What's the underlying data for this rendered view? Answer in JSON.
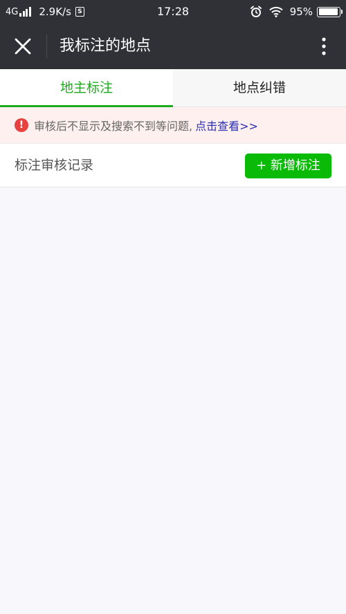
{
  "status_bar": {
    "network": "4G",
    "speed": "2.9K/s",
    "sim_label": "S",
    "time": "17:28",
    "battery": "95%"
  },
  "nav": {
    "title": "我标注的地点"
  },
  "tabs": [
    {
      "label": "地主标注",
      "active": true
    },
    {
      "label": "地点纠错",
      "active": false
    }
  ],
  "notice": {
    "text": "审核后不显示及搜索不到等问题,",
    "link": "点击查看>>"
  },
  "records": {
    "label": "标注审核记录",
    "add_button": "+ 新增标注"
  },
  "colors": {
    "accent": "#1aad19",
    "button": "#09bb07",
    "warning": "#e64340",
    "link": "#2a2fb1",
    "header": "#2f3136"
  }
}
